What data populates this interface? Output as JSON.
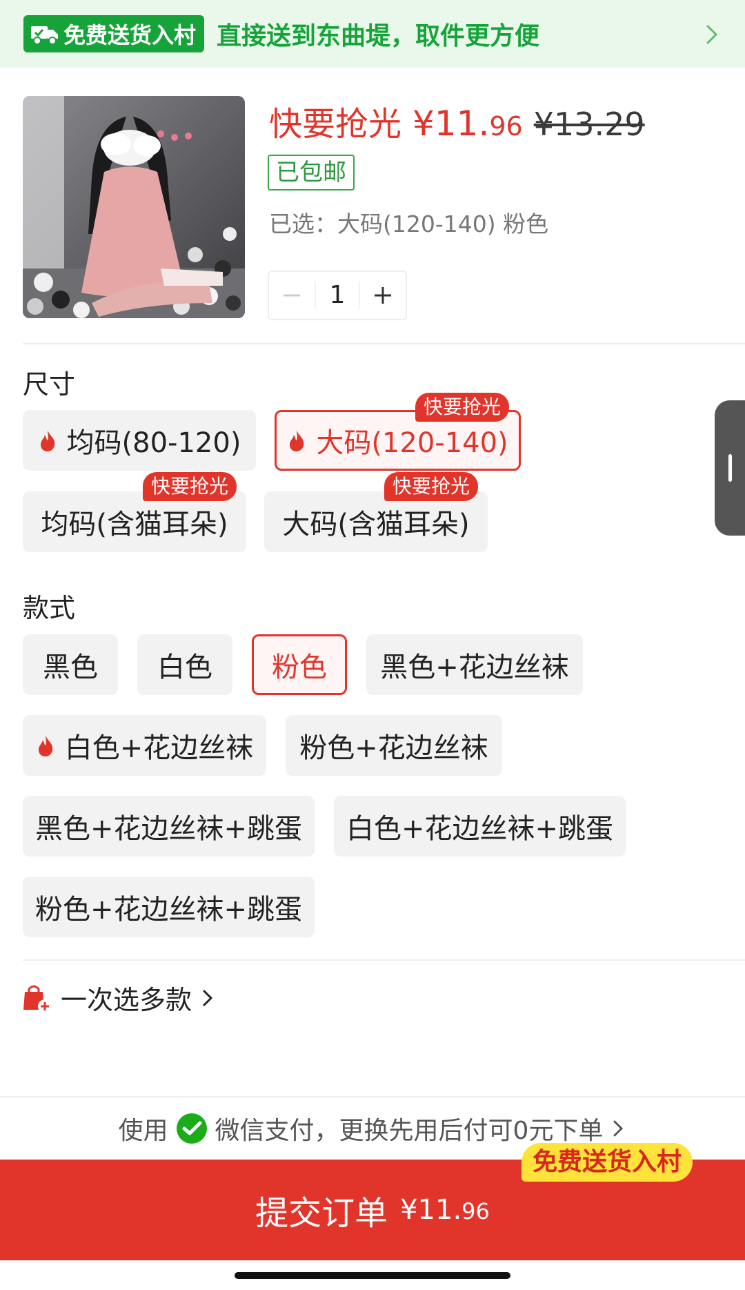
{
  "banner": {
    "badge_label": "免费送货入村",
    "text": "直接送到东曲堤，取件更方便"
  },
  "product": {
    "hot_label": "快要抢光",
    "price_main": "¥11.",
    "price_decimal": "96",
    "original_price": "¥13.29",
    "shipping_badge": "已包邮",
    "selected_text": "已选：大码(120-140) 粉色",
    "quantity": "1"
  },
  "size_section": {
    "title": "尺寸",
    "options": [
      {
        "label": "均码(80-120)",
        "hot_icon": true,
        "selected": false,
        "tag": ""
      },
      {
        "label": "大码(120-140)",
        "hot_icon": true,
        "selected": true,
        "tag": "快要抢光"
      },
      {
        "label": "均码(含猫耳朵)",
        "hot_icon": false,
        "selected": false,
        "tag": "快要抢光"
      },
      {
        "label": "大码(含猫耳朵)",
        "hot_icon": false,
        "selected": false,
        "tag": "快要抢光"
      }
    ]
  },
  "style_section": {
    "title": "款式",
    "options": [
      {
        "label": "黑色",
        "hot_icon": false,
        "selected": false
      },
      {
        "label": "白色",
        "hot_icon": false,
        "selected": false
      },
      {
        "label": "粉色",
        "hot_icon": false,
        "selected": true
      },
      {
        "label": "黑色+花边丝袜",
        "hot_icon": false,
        "selected": false
      },
      {
        "label": "白色+花边丝袜",
        "hot_icon": true,
        "selected": false
      },
      {
        "label": "粉色+花边丝袜",
        "hot_icon": false,
        "selected": false
      },
      {
        "label": "黑色+花边丝袜+跳蛋",
        "hot_icon": false,
        "selected": false
      },
      {
        "label": "白色+花边丝袜+跳蛋",
        "hot_icon": false,
        "selected": false
      },
      {
        "label": "粉色+花边丝袜+跳蛋",
        "hot_icon": false,
        "selected": false
      }
    ]
  },
  "multi_select": {
    "label": "一次选多款"
  },
  "payment": {
    "prefix": "使用",
    "text": "微信支付，更换先用后付可0元下单"
  },
  "submit": {
    "label": "提交订单",
    "amount_main": "¥11.",
    "amount_decimal": "96",
    "badge": "免费送货入村"
  },
  "colors": {
    "accent_red": "#e1352c",
    "green": "#16a43a",
    "banner_bg": "#e9f8ea",
    "badge_yellow": "#ffe23a"
  }
}
